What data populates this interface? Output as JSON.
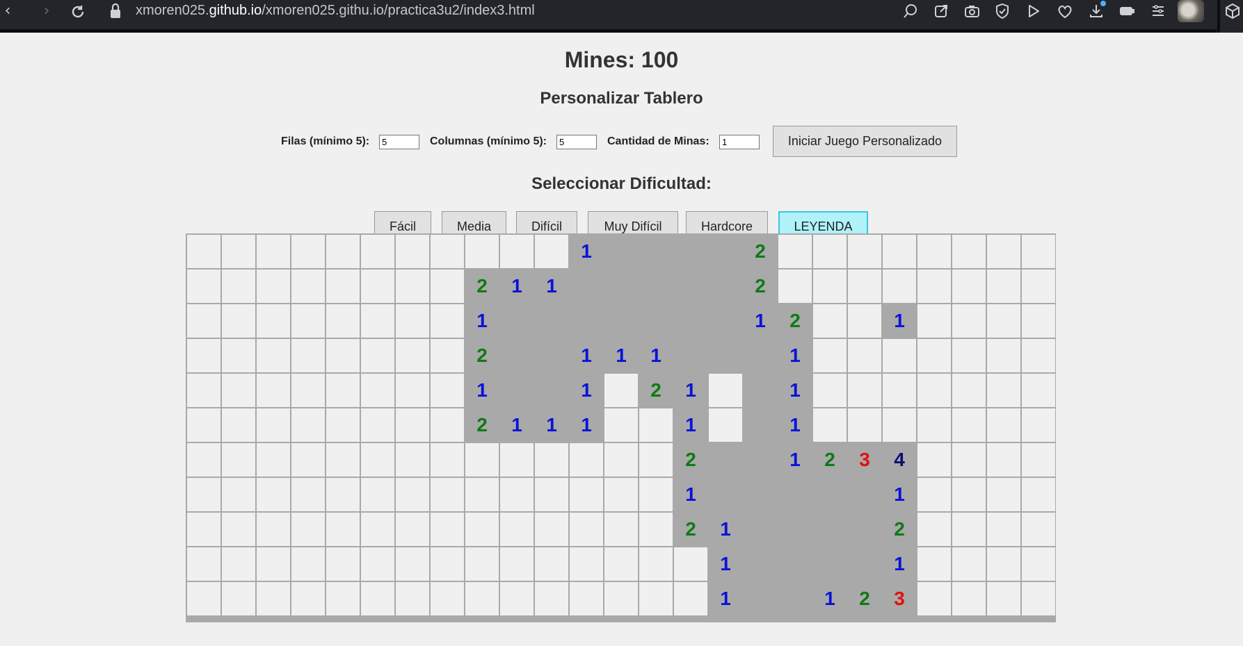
{
  "browser": {
    "url_prefix": "xmoren025.",
    "url_domain": "github.io",
    "url_path": "/xmoren025.githu.io/practica3u2/index3.html"
  },
  "game": {
    "mines_label": "Mines: 100",
    "customize_title": "Personalizar Tablero",
    "rows_label": "Filas (mínimo 5):",
    "rows_value": "5",
    "cols_label": "Columnas (mínimo 5):",
    "cols_value": "5",
    "mines_count_label": "Cantidad de Minas:",
    "mines_count_value": "1",
    "start_custom_button": "Iniciar Juego Personalizado",
    "difficulty_title": "Seleccionar Dificultad:",
    "difficulty_buttons": [
      "Fácil",
      "Media",
      "Difícil",
      "Muy Difícil",
      "Hardcore",
      "LEYENDA"
    ]
  },
  "board": {
    "columns": 25,
    "visible_rows": 11,
    "rows": [
      "__________.1____2________",
      "________211_____2._______",
      "________1_______12_.1____",
      "________2__111___1_______",
      "________1__1.21__1_______",
      "________2111..1__1_______",
      "______________2__1234____",
      "______________1_____1____",
      "______________21____2____",
      "_______________1____1____",
      "_______________1__123____"
    ]
  },
  "colors": {
    "number_1": "#0a13d8",
    "number_2": "#0f7a14",
    "number_3": "#e01010",
    "number_4": "#0b0f6e",
    "revealed_cell": "#a9a9a9",
    "hidden_cell": "#f0f0f0",
    "leyenda_button": "#b0f2fa"
  }
}
